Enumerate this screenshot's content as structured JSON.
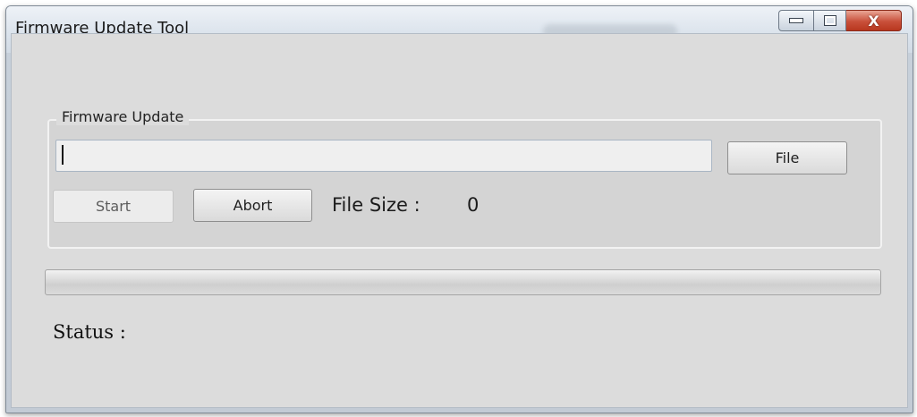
{
  "window": {
    "title": "Firmware Update Tool",
    "close_glyph": "X"
  },
  "group": {
    "legend": "Firmware Update"
  },
  "file_path": {
    "value": ""
  },
  "buttons": {
    "file_label": "File",
    "start_label": "Start",
    "abort_label": "Abort"
  },
  "file_size": {
    "label": "File Size :",
    "value": "0"
  },
  "progress": {
    "fraction": 0
  },
  "status": {
    "label": "Status :"
  },
  "icons": {
    "minimize": "minimize-icon",
    "maximize": "maximize-icon",
    "close": "close-icon"
  },
  "colors": {
    "close_button": "#c9503a",
    "client_background": "#dcdcdc"
  }
}
